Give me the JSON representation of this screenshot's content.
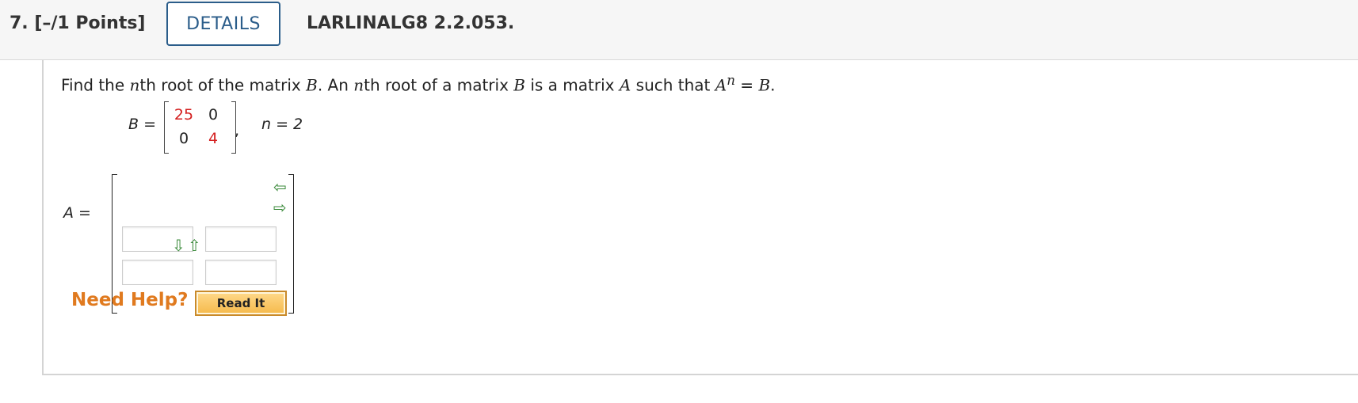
{
  "header": {
    "question_number": "7. [–/1 Points]",
    "details_label": "DETAILS",
    "question_id": "LARLINALG8 2.2.053."
  },
  "problem": {
    "text_parts": [
      "Find the ",
      "n",
      "th root of the matrix ",
      "B",
      ". An ",
      "n",
      "th root of a matrix ",
      "B",
      " is a matrix ",
      "A",
      " such that  ",
      "A",
      "n",
      " = ",
      "B",
      "."
    ],
    "b_label": "B =",
    "b_matrix": [
      [
        "25",
        "0"
      ],
      [
        "0",
        "4"
      ]
    ],
    "b_red_cells": [
      "25",
      "4"
    ],
    "comma": ",",
    "n_label": "n = 2",
    "a_label": "A =",
    "a_inputs": [
      "",
      "",
      "",
      ""
    ]
  },
  "colors": {
    "red_value": "#d42020",
    "accent_blue": "#2b5d8a",
    "help_orange": "#e07a1f",
    "arrow_green": "#3a8a3a"
  },
  "icons": {
    "left": "arrow-left-icon",
    "right": "arrow-right-icon",
    "down": "arrow-down-icon",
    "up": "arrow-up-icon"
  },
  "help": {
    "need_help": "Need Help?",
    "read_it": "Read It"
  }
}
